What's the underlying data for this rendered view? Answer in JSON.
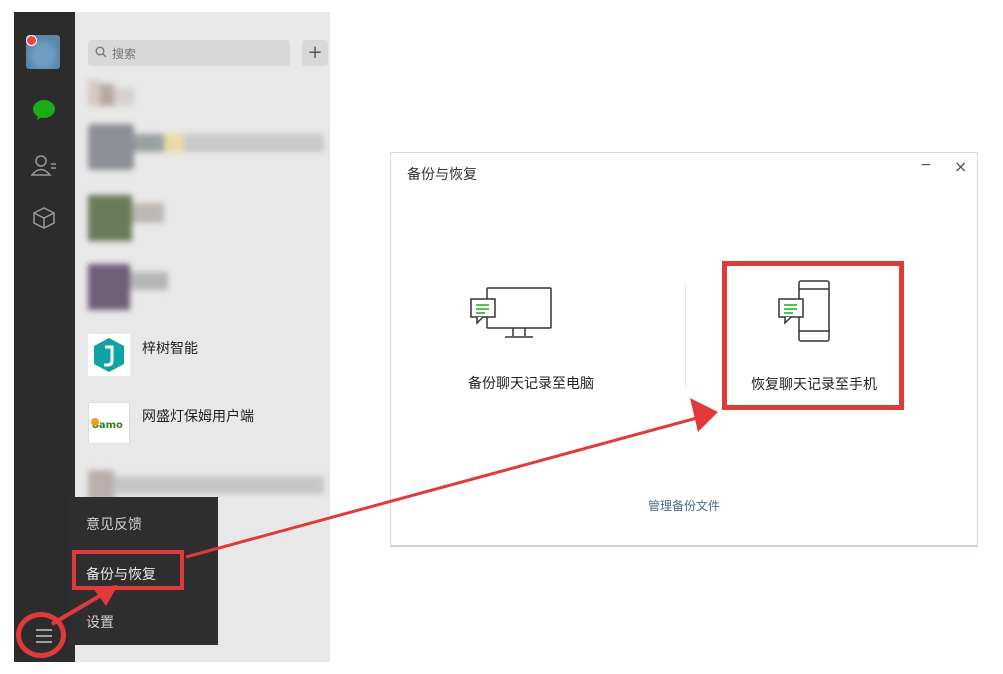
{
  "wechat": {
    "search_placeholder": "搜索",
    "add_label": "+",
    "contacts": [
      {
        "name": "梓树智能"
      },
      {
        "name": "网盛灯保姆用户端"
      }
    ],
    "popup_menu": {
      "items": [
        {
          "label": "意见反馈"
        },
        {
          "label": "备份与恢复"
        },
        {
          "label": "设置"
        }
      ]
    }
  },
  "dialog": {
    "title": "备份与恢复",
    "minimize_label": "−",
    "close_label": "×",
    "backup_to_pc": "备份聊天记录至电脑",
    "restore_to_phone": "恢复聊天记录至手机",
    "manage_files": "管理备份文件"
  },
  "colors": {
    "highlight": "#e03a3a",
    "accent_green": "#1aad19",
    "sidebar_bg": "#2c2c2c"
  }
}
